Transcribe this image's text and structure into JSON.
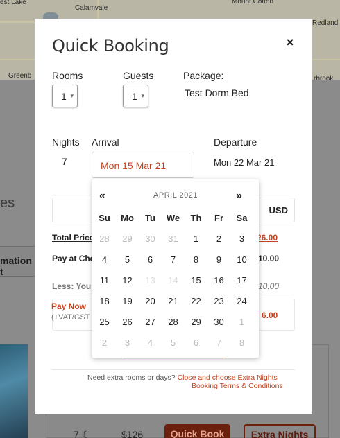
{
  "background": {
    "map_labels": [
      "est Lake",
      "Calamvale",
      "Mount Cotton",
      "Redland",
      "Greenb",
      "rbrook"
    ],
    "partial_heading": "es",
    "info_pill": "mation t",
    "room_row": {
      "nights": "7",
      "price": "$126",
      "quick_book": "Quick Book",
      "extra_nights": "Extra Nights"
    }
  },
  "modal": {
    "title": "Quick Booking",
    "close_symbol": "×",
    "rooms_label": "Rooms",
    "rooms_value": "1",
    "guests_label": "Guests",
    "guests_value": "1",
    "package_label": "Package:",
    "package_value": "Test Dorm Bed",
    "nights_label": "Nights",
    "nights_value": "7",
    "arrival_label": "Arrival",
    "arrival_value": "Mon 15 Mar 21",
    "departure_label": "Departure",
    "departure_value": "Mon 22 Mar 21",
    "currency": "USD",
    "total_price_label": "Total Price",
    "total_price_value": "26.00",
    "pay_at_checkin_label": "Pay at Che",
    "pay_at_checkin_value": "10.00",
    "less_label": "Less: Your",
    "less_value": "10.00",
    "pay_now_label": "Pay Now",
    "pay_now_vat": "(+VAT/GST",
    "pay_now_value": "6.00",
    "footer_text": "Need extra rooms or days?",
    "footer_link_extra": "Close and choose Extra Nights",
    "footer_link_terms": "Booking Terms & Conditions"
  },
  "datepicker": {
    "prev": "«",
    "next": "»",
    "month": "APRIL 2021",
    "weekdays": [
      "Su",
      "Mo",
      "Tu",
      "We",
      "Th",
      "Fr",
      "Sa"
    ],
    "weeks": [
      [
        {
          "d": "28",
          "s": "muted"
        },
        {
          "d": "29",
          "s": "muted"
        },
        {
          "d": "30",
          "s": "muted"
        },
        {
          "d": "31",
          "s": "muted"
        },
        {
          "d": "1",
          "s": ""
        },
        {
          "d": "2",
          "s": ""
        },
        {
          "d": "3",
          "s": ""
        }
      ],
      [
        {
          "d": "4",
          "s": ""
        },
        {
          "d": "5",
          "s": ""
        },
        {
          "d": "6",
          "s": ""
        },
        {
          "d": "7",
          "s": ""
        },
        {
          "d": "8",
          "s": ""
        },
        {
          "d": "9",
          "s": ""
        },
        {
          "d": "10",
          "s": ""
        }
      ],
      [
        {
          "d": "11",
          "s": ""
        },
        {
          "d": "12",
          "s": ""
        },
        {
          "d": "13",
          "s": "disabled"
        },
        {
          "d": "14",
          "s": "disabled"
        },
        {
          "d": "15",
          "s": ""
        },
        {
          "d": "16",
          "s": ""
        },
        {
          "d": "17",
          "s": ""
        }
      ],
      [
        {
          "d": "18",
          "s": ""
        },
        {
          "d": "19",
          "s": ""
        },
        {
          "d": "20",
          "s": ""
        },
        {
          "d": "21",
          "s": ""
        },
        {
          "d": "22",
          "s": ""
        },
        {
          "d": "23",
          "s": ""
        },
        {
          "d": "24",
          "s": ""
        }
      ],
      [
        {
          "d": "25",
          "s": ""
        },
        {
          "d": "26",
          "s": ""
        },
        {
          "d": "27",
          "s": ""
        },
        {
          "d": "28",
          "s": ""
        },
        {
          "d": "29",
          "s": ""
        },
        {
          "d": "30",
          "s": ""
        },
        {
          "d": "1",
          "s": "muted"
        }
      ],
      [
        {
          "d": "2",
          "s": "muted"
        },
        {
          "d": "3",
          "s": "muted"
        },
        {
          "d": "4",
          "s": "muted"
        },
        {
          "d": "5",
          "s": "muted"
        },
        {
          "d": "6",
          "s": "muted"
        },
        {
          "d": "7",
          "s": "muted"
        },
        {
          "d": "8",
          "s": "muted"
        }
      ]
    ]
  },
  "colors": {
    "accent": "#c4411c",
    "overlay": "#8a8a8a",
    "dark_button": "#6b200d"
  }
}
